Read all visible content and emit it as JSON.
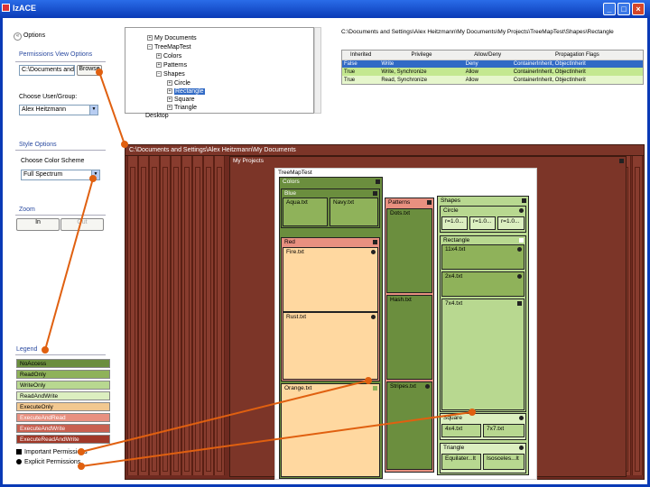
{
  "window": {
    "title": "IzACE"
  },
  "options": {
    "header": "Options"
  },
  "perm_view": {
    "group": "Permissions View Options",
    "path_value": "C:\\Documents and S",
    "browse": "Browse"
  },
  "user_group": {
    "label": "Choose User/Group:",
    "value": "Alex Heitzmann"
  },
  "style": {
    "group": "Style Options",
    "label": "Choose Color Scheme",
    "value": "Full Spectrum"
  },
  "zoom": {
    "group": "Zoom",
    "in": "In",
    "out": "Out"
  },
  "tree": {
    "items": [
      "My Documents",
      "TreeMapTest",
      "Colors",
      "Patterns",
      "Shapes",
      "Circle",
      "Rectangle",
      "Square",
      "Triangle",
      "Desktop"
    ]
  },
  "acl": {
    "path": "C:\\Documents and Settings\\Alex Heitzmann\\My Documents\\My Projects\\TreeMapTest\\Shapes\\Rectangle",
    "headers": [
      "Inherited",
      "Privilege",
      "Allow/Deny",
      "Propagation Flags"
    ],
    "rows": [
      [
        "False",
        "Write",
        "Deny",
        "ContainerInherit, ObjectInherit"
      ],
      [
        "True",
        "Write, Synchronize",
        "Allow",
        "ContainerInherit, ObjectInherit"
      ],
      [
        "True",
        "Read, Synchronize",
        "Allow",
        "ContainerInherit, ObjectInherit"
      ]
    ]
  },
  "treemap": {
    "header": "C:\\Documents and Settings\\Alex Heitzmann\\My Documents",
    "myprojects": "My Projects",
    "root": "TreeMapTest",
    "colors": "Colors",
    "blue": "Blue",
    "aqua": "Aqua.txt",
    "navy": "Navy.txt",
    "red": "Red",
    "fire": "Fire.txt",
    "rust": "Rust.txt",
    "orange": "Orange.txt",
    "patterns": "Patterns",
    "dots": "Dots.txt",
    "hash": "Hash.txt",
    "stripes": "Stripes.txt",
    "shapes": "Shapes",
    "circle": "Circle",
    "r1": "r=1.0...",
    "r2": "r=1.0...",
    "r3": "r=1.0...",
    "rectangle": "Rectangle",
    "f11x4": "11x4.txt",
    "f2x4": "2x4.txt",
    "f7x4": "7x4.txt",
    "square": "Square",
    "f4x4": "4x4.txt",
    "f7x7": "7x7.txt",
    "triangle": "Triangle",
    "equil": "Equilater...lt",
    "isos": "Isosceles...lt"
  },
  "legend": {
    "group": "Legend",
    "items": [
      "NoAccess",
      "ReadOnly",
      "WriteOnly",
      "ReadAndWrite",
      "ExecuteOnly",
      "ExecuteAndRead",
      "ExecuteAndWrite",
      "ExecuteReadAndWrite"
    ],
    "colors": [
      "#6b8e3e",
      "#8fb25a",
      "#b8d890",
      "#dcefc0",
      "#f2c890",
      "#e89080",
      "#c86050",
      "#a03828"
    ],
    "important": "Important Permissions",
    "explicit": "Explicit Permissions"
  },
  "colors": {
    "annotation": "#e06010",
    "accent": "#316ac5"
  }
}
